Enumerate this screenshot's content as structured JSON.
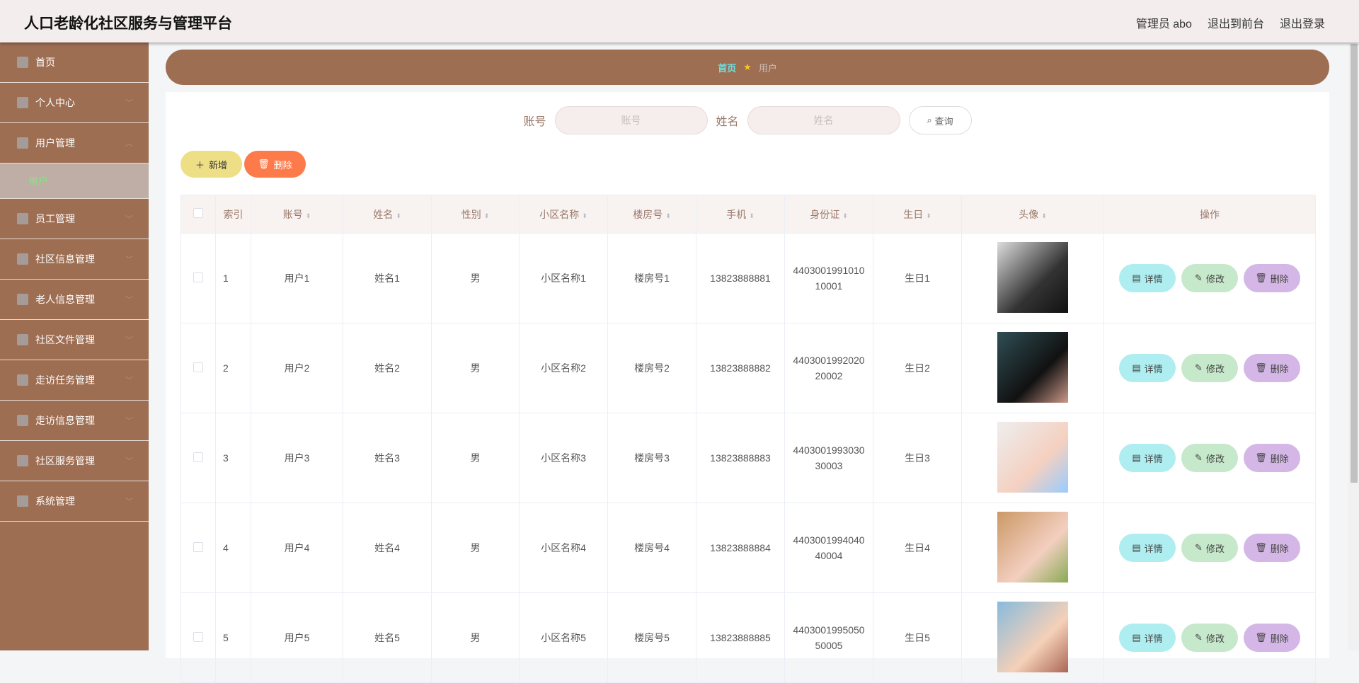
{
  "header": {
    "title": "人口老龄化社区服务与管理平台",
    "user": "管理员 abo",
    "to_front": "退出到前台",
    "logout": "退出登录"
  },
  "sidebar": {
    "items": [
      {
        "label": "首页",
        "icon": "home-icon"
      },
      {
        "label": "个人中心",
        "icon": "user-icon"
      },
      {
        "label": "用户管理",
        "icon": "suitcase-icon",
        "expanded": true,
        "children": [
          {
            "label": "用户",
            "active": true
          }
        ]
      },
      {
        "label": "员工管理",
        "icon": "send-icon"
      },
      {
        "label": "社区信息管理",
        "icon": "goods-icon"
      },
      {
        "label": "老人信息管理",
        "icon": "full-screen-icon"
      },
      {
        "label": "社区文件管理",
        "icon": "list-icon"
      },
      {
        "label": "走访任务管理",
        "icon": "postcard-icon"
      },
      {
        "label": "走访信息管理",
        "icon": "grid-icon"
      },
      {
        "label": "社区服务管理",
        "icon": "data-icon"
      },
      {
        "label": "系统管理",
        "icon": "message-icon"
      }
    ]
  },
  "breadcrumb": {
    "home": "首页",
    "current": "用户"
  },
  "search": {
    "account_label": "账号",
    "account_placeholder": "账号",
    "name_label": "姓名",
    "name_placeholder": "姓名",
    "query": "查询"
  },
  "toolbar": {
    "add": "新增",
    "delete": "删除"
  },
  "table": {
    "headers": [
      "索引",
      "账号",
      "姓名",
      "性别",
      "小区名称",
      "楼房号",
      "手机",
      "身份证",
      "生日",
      "头像",
      "操作"
    ],
    "rows": [
      {
        "index": "1",
        "account": "用户1",
        "name": "姓名1",
        "gender": "男",
        "community": "小区名称1",
        "building": "楼房号1",
        "phone": "13823888881",
        "id_card": "440300199101010001",
        "birthday": "生日1"
      },
      {
        "index": "2",
        "account": "用户2",
        "name": "姓名2",
        "gender": "男",
        "community": "小区名称2",
        "building": "楼房号2",
        "phone": "13823888882",
        "id_card": "440300199202020002",
        "birthday": "生日2"
      },
      {
        "index": "3",
        "account": "用户3",
        "name": "姓名3",
        "gender": "男",
        "community": "小区名称3",
        "building": "楼房号3",
        "phone": "13823888883",
        "id_card": "440300199303030003",
        "birthday": "生日3"
      },
      {
        "index": "4",
        "account": "用户4",
        "name": "姓名4",
        "gender": "男",
        "community": "小区名称4",
        "building": "楼房号4",
        "phone": "13823888884",
        "id_card": "440300199404040004",
        "birthday": "生日4"
      },
      {
        "index": "5",
        "account": "用户5",
        "name": "姓名5",
        "gender": "男",
        "community": "小区名称5",
        "building": "楼房号5",
        "phone": "13823888885",
        "id_card": "440300199505050005",
        "birthday": "生日5"
      }
    ],
    "actions": {
      "detail": "详情",
      "edit": "修改",
      "delete": "删除"
    }
  },
  "colors": {
    "sidebar": "#9e6e53",
    "header": "#f3eded",
    "active": "#7ee87e"
  }
}
